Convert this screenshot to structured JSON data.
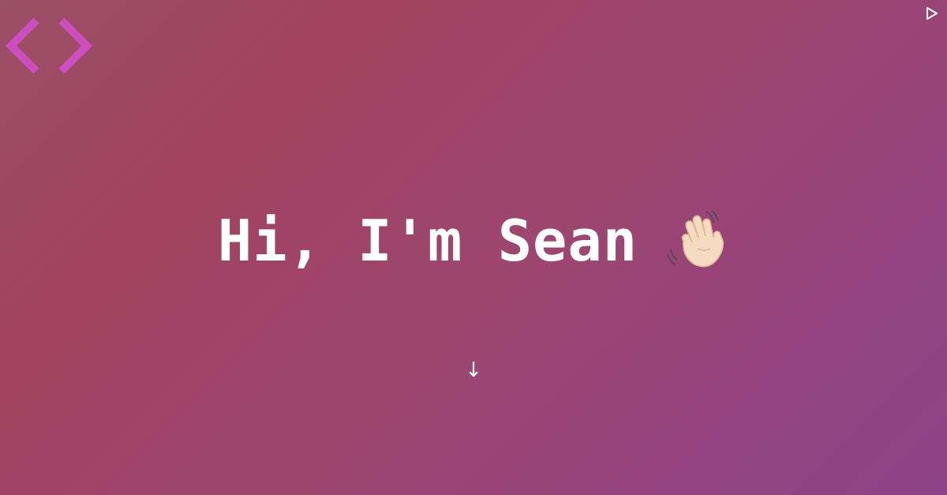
{
  "logo": {
    "icon": "code-brackets-icon",
    "color": "#cc4fc0"
  },
  "controls": {
    "play_icon": "play-icon"
  },
  "hero": {
    "greeting": "Hi, I'm Sean",
    "emoji_icon": "waving-hand-icon"
  },
  "scroll": {
    "arrow": "↓",
    "icon": "arrow-down-icon"
  },
  "colors": {
    "text": "#ffffff",
    "accent": "#cc4fc0"
  }
}
